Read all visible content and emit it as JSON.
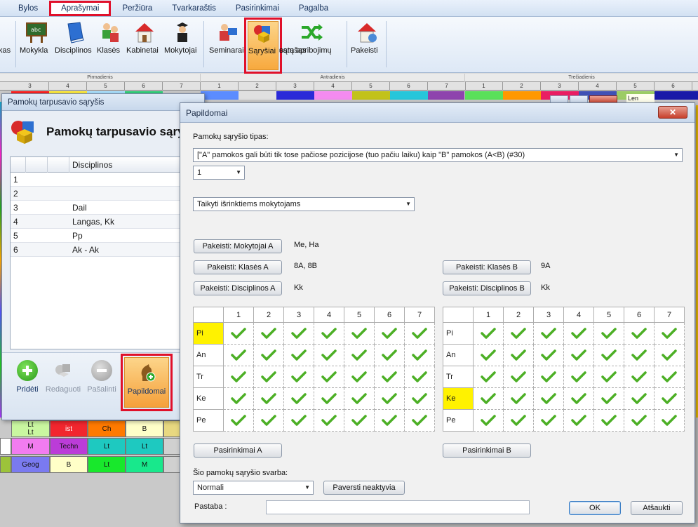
{
  "menu": [
    "Bylos",
    "Aprašymai",
    "Peržiūra",
    "Tvarkaraštis",
    "Pasirinkimai",
    "Pagalba"
  ],
  "menu_active": "Aprašymai",
  "ribbon": {
    "edge_label": "kas",
    "buttons": [
      {
        "label": "Mokykla"
      },
      {
        "label": "Disciplinos"
      },
      {
        "label": "Klasės"
      },
      {
        "label": "Kabinetai"
      },
      {
        "label": "Mokytojai"
      },
      {
        "label": "Seminarai"
      },
      {
        "label": "Sąryšiai"
      },
      {
        "label": "estų apribojimų",
        "label2": "sąrašas"
      },
      {
        "label": "Pakeisti"
      }
    ]
  },
  "timetable": {
    "days": [
      "Pirmadienis",
      "Antradienis",
      "Trečiadienis"
    ],
    "periods_row": [
      "3",
      "4",
      "5",
      "6",
      "7",
      "1",
      "2",
      "3",
      "4",
      "5",
      "6",
      "7",
      "1",
      "2",
      "3",
      "4",
      "5",
      "6"
    ],
    "right_label": "Len",
    "rows": [
      [
        {
          "t": "Lt\nLt",
          "c": "#c9f7a0"
        },
        {
          "t": "ist",
          "c": "#f2262e"
        },
        {
          "t": "Ch",
          "c": "#ff7a00"
        },
        {
          "t": "B",
          "c": "#ffffc8"
        }
      ],
      [
        {
          "t": "M",
          "c": "#f27cf0"
        },
        {
          "t": "Techn",
          "c": "#bb3cd8"
        },
        {
          "t": "Lt",
          "c": "#1ec9c0"
        },
        {
          "t": "Lt",
          "c": "#1ec9c0"
        }
      ],
      [
        {
          "t": "Geog",
          "c": "#7a7af0"
        },
        {
          "t": "B",
          "c": "#ffffc8"
        },
        {
          "t": "Lt",
          "c": "#18e82c"
        },
        {
          "t": "M",
          "c": "#18e88c"
        }
      ]
    ]
  },
  "dlg1": {
    "title": "Pamokų tarpusavio sąryšis",
    "header": "Pamokų tarpusavio sąryši",
    "col_header": "Disciplinos",
    "rows": [
      {
        "n": "1",
        "d": ""
      },
      {
        "n": "2",
        "d": ""
      },
      {
        "n": "3",
        "d": "Dail"
      },
      {
        "n": "4",
        "d": "Langas, Kk"
      },
      {
        "n": "5",
        "d": "Pp"
      },
      {
        "n": "6",
        "d": "Ak - Ak"
      }
    ],
    "buttons": {
      "add": "Pridėti",
      "edit": "Redaguoti",
      "remove": "Pašalinti",
      "extra": "Papildomai"
    }
  },
  "dlg2": {
    "title": "Papildomai",
    "close": "✕",
    "type_label": "Pamokų sąryšio tipas:",
    "type_value": "[\"A\" pamokos gali būti tik tose pačiose pozicijose (tuo pačiu laiku) kaip \"B\" pamokos (A<B) (#30)",
    "count_value": "1",
    "apply_value": "Taikyti išrinktiems mokytojams",
    "btn_teachers_a": "Pakeisti: Mokytojai A",
    "val_teachers_a": "Me, Ha",
    "btn_classes_a": "Pakeisti: Klasės A",
    "val_classes_a": "8A, 8B",
    "btn_subjects_a": "Pakeisti: Disciplinos A",
    "val_subjects_a": "Kk",
    "btn_classes_b": "Pakeisti: Klasės B",
    "val_classes_b": "9A",
    "btn_subjects_b": "Pakeisti: Disciplinos B",
    "val_subjects_b": "Kk",
    "grid_cols": [
      "1",
      "2",
      "3",
      "4",
      "5",
      "6",
      "7"
    ],
    "grid_rows": [
      "Pi",
      "An",
      "Tr",
      "Ke",
      "Pe"
    ],
    "grid_a_highlight_col": "6",
    "grid_a_highlight_row": "Pi",
    "grid_b_highlight_col": "1",
    "grid_b_highlight_row": "Ke",
    "btn_options_a": "Pasirinkimai A",
    "btn_options_b": "Pasirinkimai B",
    "importance_label": "Šio pamokų sąryšio svarba:",
    "importance_value": "Normali",
    "btn_deactivate": "Paversti neaktyvia",
    "note_label": "Pastaba :",
    "note_value": "",
    "ok": "OK",
    "cancel": "Atšaukti"
  },
  "colors": {
    "highlight_red": "#e0102a",
    "cell_yellow": "#fff200",
    "check_green": "#4caf25"
  }
}
